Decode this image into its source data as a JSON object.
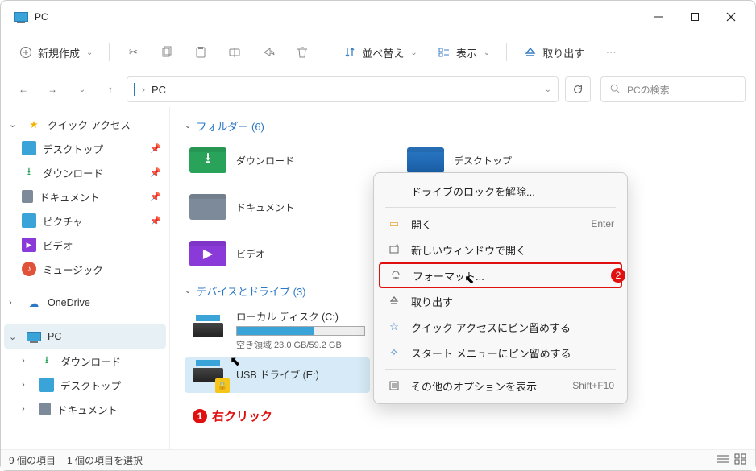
{
  "window": {
    "title": "PC"
  },
  "toolbar": {
    "new": "新規作成",
    "sort": "並べ替え",
    "view": "表示",
    "eject": "取り出す"
  },
  "nav": {
    "breadcrumb_root": "PC",
    "search_placeholder": "PCの検索"
  },
  "sidebar": {
    "quick_access": "クイック アクセス",
    "desktop": "デスクトップ",
    "downloads": "ダウンロード",
    "documents": "ドキュメント",
    "pictures": "ピクチャ",
    "videos": "ビデオ",
    "music": "ミュージック",
    "onedrive": "OneDrive",
    "pc": "PC",
    "sub_downloads": "ダウンロード",
    "sub_desktop": "デスクトップ",
    "sub_documents": "ドキュメント"
  },
  "content": {
    "folders_header": "フォルダー (6)",
    "folders": {
      "downloads": "ダウンロード",
      "desktop": "デスクトップ",
      "documents": "ドキュメント",
      "videos": "ビデオ"
    },
    "drives_header": "デバイスとドライブ (3)",
    "local_disk": {
      "name": "ローカル ディスク (C:)",
      "sub": "空き領域 23.0 GB/59.2 GB",
      "fill_pct": 61
    },
    "usb_drive": {
      "name": "USB ドライブ (E:)"
    },
    "annotation1_num": "1",
    "annotation1_text": "右クリック",
    "annotation2_num": "2"
  },
  "context_menu": {
    "unlock": "ドライブのロックを解除...",
    "open": "開く",
    "open_shortcut": "Enter",
    "open_new_window": "新しいウィンドウで開く",
    "format": "フォーマット...",
    "eject": "取り出す",
    "pin_quick": "クイック アクセスにピン留めする",
    "pin_start": "スタート メニューにピン留めする",
    "more_options": "その他のオプションを表示",
    "more_options_shortcut": "Shift+F10"
  },
  "status": {
    "items": "9 個の項目",
    "selected": "1 個の項目を選択"
  }
}
